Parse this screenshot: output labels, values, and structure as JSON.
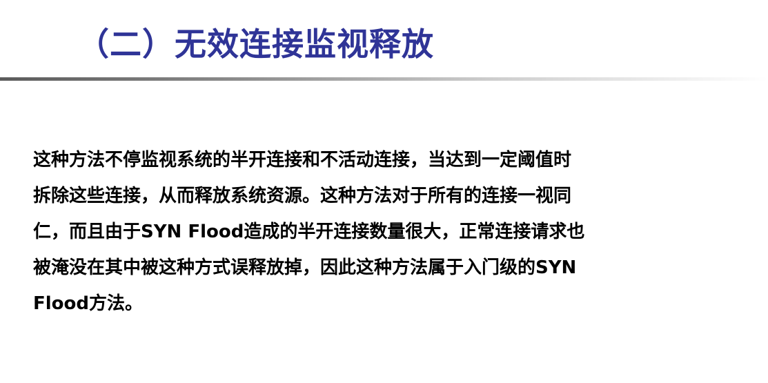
{
  "slide": {
    "title": "（二）无效连接监视释放",
    "body_lines": [
      "这种方法不停监视系统的半开连接和不活动连接，当达到一定阈值时",
      "拆除这些连接，从而释放系统资源。这种方法对于所有的连接一视同",
      "仁，而且由于SYN Flood造成的半开连接数量很大，正常连接请求也",
      "被淹没在其中被这种方式误释放掉，因此这种方法属于入门级的SYN",
      "Flood方法。"
    ]
  },
  "colors": {
    "title": "#2f3497",
    "body": "#000000",
    "rule": "#5b5b5b",
    "background": "#ffffff"
  }
}
